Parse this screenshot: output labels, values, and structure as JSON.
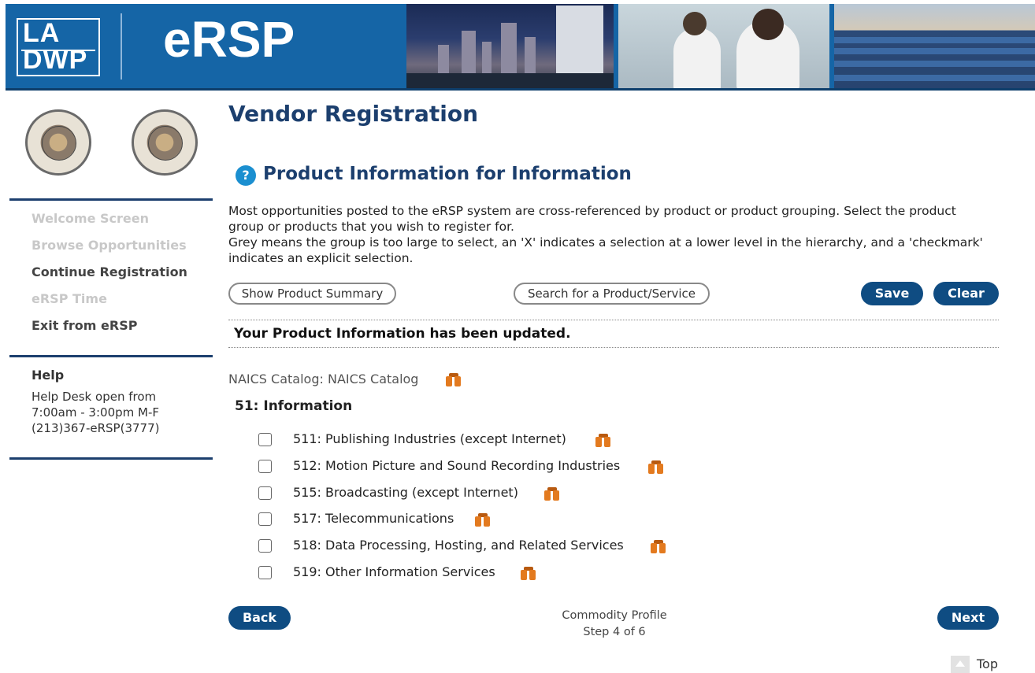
{
  "header": {
    "logo_line1": "LA",
    "logo_line2": "DWP",
    "app_title": "eRSP",
    "brand_color": "#1565a6"
  },
  "sidebar": {
    "nav": [
      {
        "label": "Welcome Screen",
        "state": "disabled"
      },
      {
        "label": "Browse Opportunities",
        "state": "disabled"
      },
      {
        "label": "Continue Registration",
        "state": "active"
      },
      {
        "label": "eRSP Time",
        "state": "disabled"
      },
      {
        "label": "Exit from eRSP",
        "state": "active"
      }
    ],
    "help": {
      "title": "Help",
      "text": "Help Desk open from\n7:00am - 3:00pm M-F\n(213)367-eRSP(3777)"
    }
  },
  "main": {
    "page_title": "Vendor Registration",
    "section_title": "Product Information for Information",
    "help_icon": "?",
    "intro": "Most opportunities posted to the eRSP system are cross-referenced by product or product grouping. Select the product group or products that you wish to register for.",
    "intro2": "Grey means the group is too large to select, an 'X' indicates a selection at a lower level in the hierarchy, and a 'checkmark' indicates an explicit selection.",
    "buttons": {
      "show_summary": "Show Product Summary",
      "search": "Search for a Product/Service",
      "save": "Save",
      "clear": "Clear",
      "back": "Back",
      "next": "Next"
    },
    "status_message": "Your Product Information has been updated.",
    "catalog_label": "NAICS Catalog: NAICS Catalog",
    "group_title": "51: Information",
    "items": [
      {
        "label": "511: Publishing Industries (except Internet)",
        "checked": false
      },
      {
        "label": "512: Motion Picture and Sound Recording Industries",
        "checked": false
      },
      {
        "label": "515: Broadcasting (except Internet)",
        "checked": false
      },
      {
        "label": "517: Telecommunications",
        "checked": false
      },
      {
        "label": "518: Data Processing, Hosting, and Related Services",
        "checked": false
      },
      {
        "label": "519: Other Information Services",
        "checked": false
      }
    ],
    "step": {
      "name": "Commodity Profile",
      "progress": "Step 4 of 6"
    },
    "top_link": "Top"
  },
  "colors": {
    "navy": "#1c3f6e",
    "button_blue": "#0f4c82",
    "binoculars": "#e37a1f",
    "disabled_text": "#c8c8c8"
  }
}
